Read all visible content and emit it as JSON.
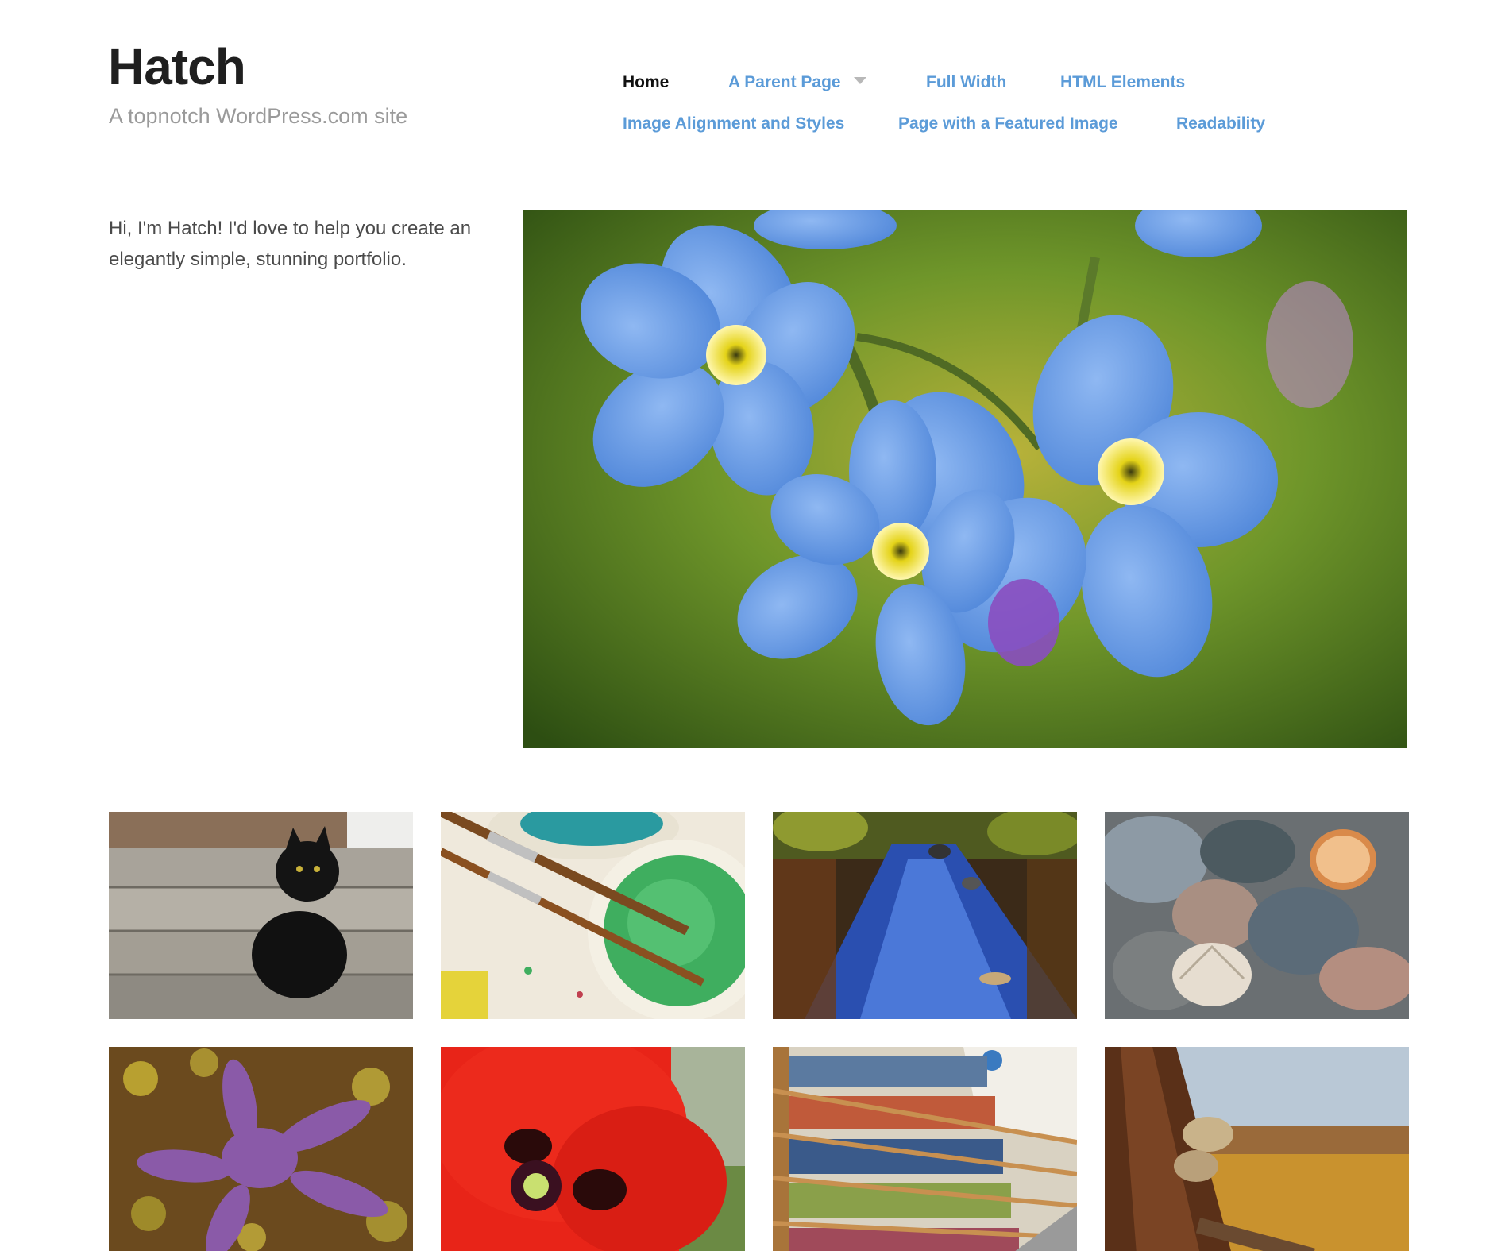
{
  "site": {
    "title": "Hatch",
    "tagline": "A topnotch WordPress.com site"
  },
  "nav": {
    "items": [
      {
        "label": "Home",
        "active": true
      },
      {
        "label": "A Parent Page",
        "has_dropdown": true
      },
      {
        "label": "Full Width"
      },
      {
        "label": "HTML Elements"
      },
      {
        "label": "Image Alignment and Styles"
      },
      {
        "label": "Page with a Featured Image"
      },
      {
        "label": "Readability"
      }
    ]
  },
  "intro": {
    "text": "Hi, I'm Hatch! I'd love to help you create an elegantly simple, stunning portfolio."
  },
  "featured_image": {
    "subject": "blue forget-me-not flowers"
  },
  "portfolio": [
    {
      "subject": "black cat on wooden steps"
    },
    {
      "subject": "paint brushes and watercolor paints"
    },
    {
      "subject": "forest stream"
    },
    {
      "subject": "seashells and pebbles"
    },
    {
      "subject": "purple starfish"
    },
    {
      "subject": "red poppy flower"
    },
    {
      "subject": "library bookshelves"
    },
    {
      "subject": "mushroom on tree trunk in field"
    }
  ],
  "colors": {
    "link": "#5b9bd8",
    "active_link": "#111111",
    "tagline": "#9a9a9a",
    "body_text": "#4a4a4a"
  }
}
